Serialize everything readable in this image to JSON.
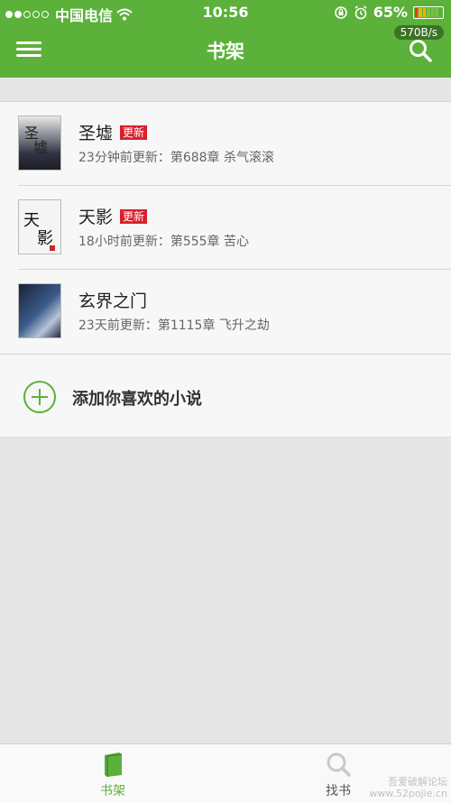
{
  "status_bar": {
    "carrier": "中国电信",
    "time": "10:56",
    "battery_percent": "65%",
    "battery_level": 0.65
  },
  "net_speed": "570B/s",
  "nav": {
    "title": "书架",
    "menu_icon": "menu-icon",
    "search_icon": "search-icon"
  },
  "books": [
    {
      "title": "圣墟",
      "badge": "更新",
      "update_info": "23分钟前更新：第688章 杀气滚滚",
      "cover_color": "#3a3a48"
    },
    {
      "title": "天影",
      "badge": "更新",
      "update_info": "18小时前更新：第555章 苦心",
      "cover_color": "#f2f2f2"
    },
    {
      "title": "玄界之门",
      "badge": "",
      "update_info": "23天前更新：第1115章 飞升之劫",
      "cover_color": "#26304a"
    }
  ],
  "add_novel": {
    "label": "添加你喜欢的小说",
    "icon": "plus-circle-icon"
  },
  "tabs": [
    {
      "label": "书架",
      "icon": "book-icon",
      "active": true
    },
    {
      "label": "找书",
      "icon": "search-icon",
      "active": false
    }
  ],
  "colors": {
    "accent": "#5bb13a",
    "badge": "#d9202c"
  },
  "watermark": {
    "line1": "吾爱破解论坛",
    "line2": "www.52pojie.cn"
  }
}
